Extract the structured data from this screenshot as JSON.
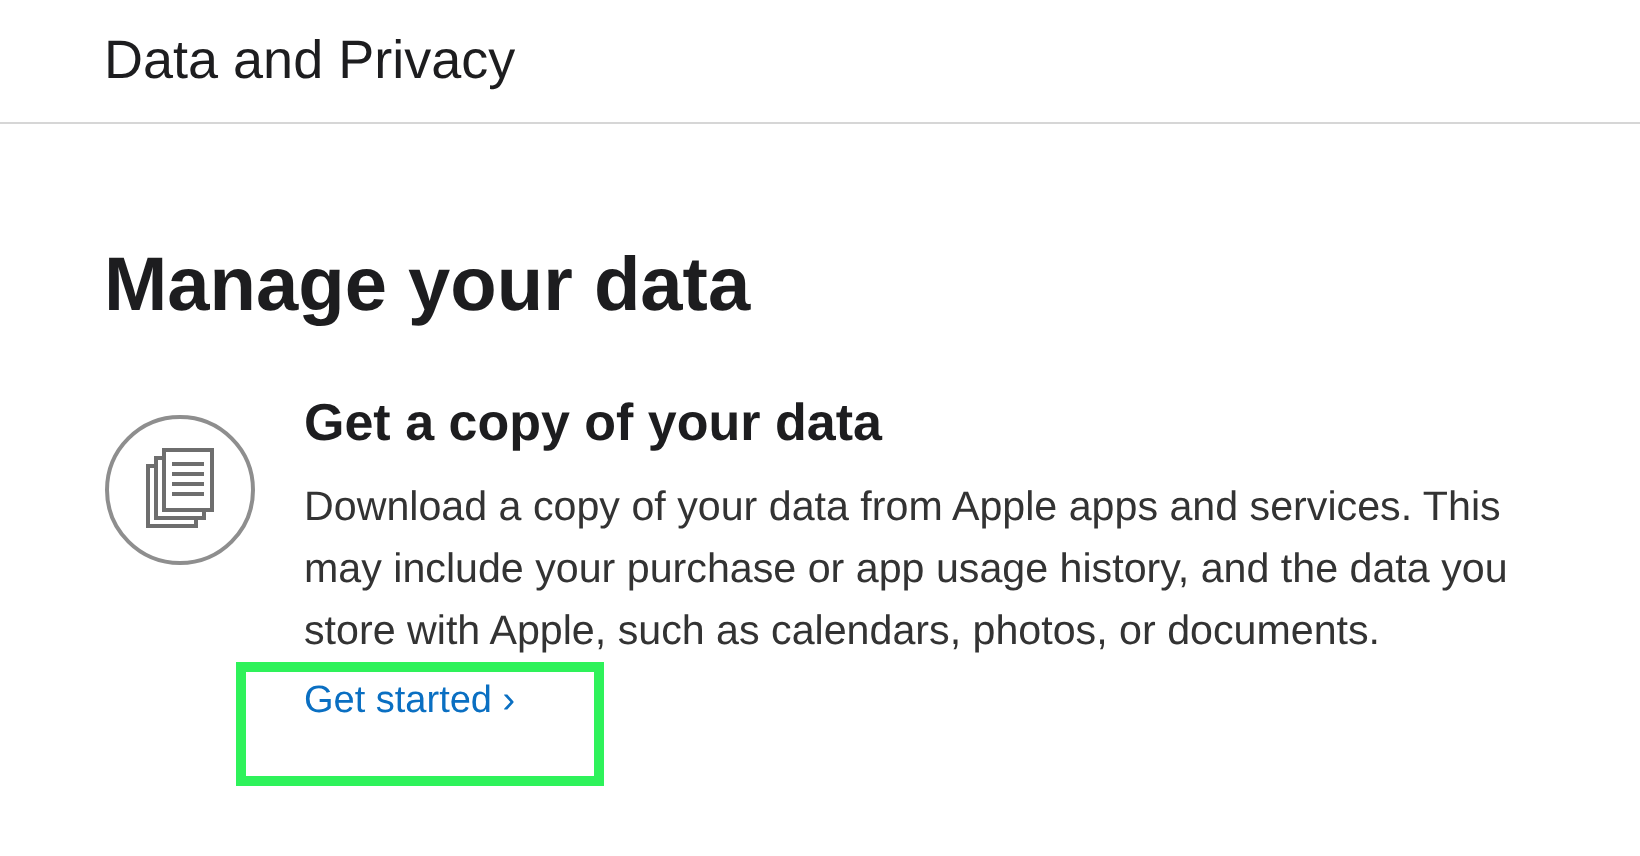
{
  "header": {
    "title": "Data and Privacy"
  },
  "section": {
    "heading": "Manage your data",
    "items": [
      {
        "title": "Get a copy of your data",
        "description": "Download a copy of your data from Apple apps and services. This may include your purchase or app usage history, and the data you store with Apple, such as calendars, photos, or documents.",
        "link": "Get started ›"
      }
    ]
  }
}
